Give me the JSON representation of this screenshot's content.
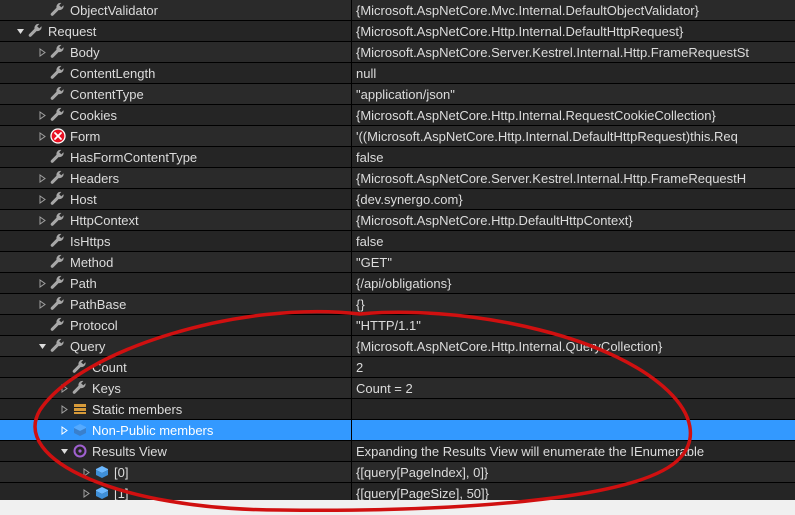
{
  "rows": [
    {
      "indent": 36,
      "expander": null,
      "icon": "wrench",
      "name": "ObjectValidator",
      "value": "{Microsoft.AspNetCore.Mvc.Internal.DefaultObjectValidator}"
    },
    {
      "indent": 14,
      "expander": "expanded",
      "icon": "wrench",
      "name": "Request",
      "value": "{Microsoft.AspNetCore.Http.Internal.DefaultHttpRequest}"
    },
    {
      "indent": 36,
      "expander": "collapsed",
      "icon": "wrench",
      "name": "Body",
      "value": "{Microsoft.AspNetCore.Server.Kestrel.Internal.Http.FrameRequestSt"
    },
    {
      "indent": 36,
      "expander": null,
      "icon": "wrench",
      "name": "ContentLength",
      "value": "null"
    },
    {
      "indent": 36,
      "expander": null,
      "icon": "wrench",
      "name": "ContentType",
      "value": "\"application/json\""
    },
    {
      "indent": 36,
      "expander": "collapsed",
      "icon": "wrench",
      "name": "Cookies",
      "value": "{Microsoft.AspNetCore.Http.Internal.RequestCookieCollection}"
    },
    {
      "indent": 36,
      "expander": "collapsed",
      "icon": "error",
      "name": "Form",
      "value": "'((Microsoft.AspNetCore.Http.Internal.DefaultHttpRequest)this.Req"
    },
    {
      "indent": 36,
      "expander": null,
      "icon": "wrench",
      "name": "HasFormContentType",
      "value": "false"
    },
    {
      "indent": 36,
      "expander": "collapsed",
      "icon": "wrench",
      "name": "Headers",
      "value": "{Microsoft.AspNetCore.Server.Kestrel.Internal.Http.FrameRequestH"
    },
    {
      "indent": 36,
      "expander": "collapsed",
      "icon": "wrench",
      "name": "Host",
      "value": "{dev.synergo.com}"
    },
    {
      "indent": 36,
      "expander": "collapsed",
      "icon": "wrench",
      "name": "HttpContext",
      "value": "{Microsoft.AspNetCore.Http.DefaultHttpContext}"
    },
    {
      "indent": 36,
      "expander": null,
      "icon": "wrench",
      "name": "IsHttps",
      "value": "false"
    },
    {
      "indent": 36,
      "expander": null,
      "icon": "wrench",
      "name": "Method",
      "value": "\"GET\""
    },
    {
      "indent": 36,
      "expander": "collapsed",
      "icon": "wrench",
      "name": "Path",
      "value": "{/api/obligations}"
    },
    {
      "indent": 36,
      "expander": "collapsed",
      "icon": "wrench",
      "name": "PathBase",
      "value": "{}"
    },
    {
      "indent": 36,
      "expander": null,
      "icon": "wrench",
      "name": "Protocol",
      "value": "\"HTTP/1.1\""
    },
    {
      "indent": 36,
      "expander": "expanded",
      "icon": "wrench",
      "name": "Query",
      "value": "{Microsoft.AspNetCore.Http.Internal.QueryCollection}"
    },
    {
      "indent": 58,
      "expander": null,
      "icon": "wrench",
      "name": "Count",
      "value": "2"
    },
    {
      "indent": 58,
      "expander": "collapsed",
      "icon": "wrench",
      "name": "Keys",
      "value": "Count = 2"
    },
    {
      "indent": 58,
      "expander": "collapsed",
      "icon": "static",
      "name": "Static members",
      "value": ""
    },
    {
      "indent": 58,
      "expander": "collapsed",
      "icon": "nonpub",
      "name": "Non-Public members",
      "value": "",
      "selected": true
    },
    {
      "indent": 58,
      "expander": "expanded",
      "icon": "results",
      "name": "Results View",
      "value": "Expanding the Results View will enumerate the IEnumerable"
    },
    {
      "indent": 80,
      "expander": "collapsed",
      "icon": "cube",
      "name": "[0]",
      "value": "{[query[PageIndex], 0]}"
    },
    {
      "indent": 80,
      "expander": "collapsed",
      "icon": "cube",
      "name": "[1]",
      "value": "{[query[PageSize], 50]}"
    }
  ]
}
